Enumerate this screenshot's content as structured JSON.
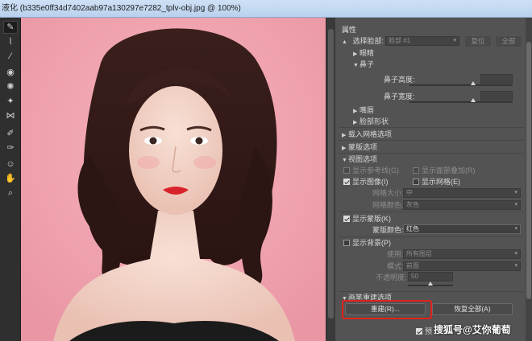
{
  "window": {
    "title": "液化 (b335e0ff34d7402aab97a130297e7282_tplv-obj.jpg @ 100%)"
  },
  "tools": [
    {
      "icon": "forward-warp-icon",
      "glyph": "✎",
      "active": true
    },
    {
      "icon": "reconstruct-icon",
      "glyph": "⌇"
    },
    {
      "icon": "smooth-icon",
      "glyph": "∕"
    },
    {
      "icon": "twirl-icon",
      "glyph": "◉"
    },
    {
      "icon": "pucker-icon",
      "glyph": "✺"
    },
    {
      "icon": "bloat-icon",
      "glyph": "✦"
    },
    {
      "icon": "push-left-icon",
      "glyph": "⋈"
    },
    {
      "icon": "freeze-mask-icon",
      "glyph": "✐"
    },
    {
      "icon": "thaw-mask-icon",
      "glyph": "✑"
    },
    {
      "icon": "face-tool-icon",
      "glyph": "☺"
    },
    {
      "icon": "hand-icon",
      "glyph": "✋"
    },
    {
      "icon": "zoom-icon",
      "glyph": "⌕"
    }
  ],
  "properties": {
    "header": "属性",
    "face_select_label": "选择脸部:",
    "face_select_value": "脸部 #1",
    "reset_label": "复位",
    "all_label": "全部",
    "eyes_label": "眼睛",
    "nose_label": "鼻子",
    "nose_height_label": "鼻子高度:",
    "nose_height_value": 0.62,
    "nose_width_label": "鼻子宽度:",
    "nose_width_value": 0.62,
    "mouth_label": "嘴唇",
    "face_shape_label": "脸部形状",
    "load_mesh_label": "载入网格选项",
    "mask_options_label": "蒙版选项",
    "view_options_label": "视图选项",
    "show_guides_label": "显示参考线(G)",
    "show_face_overlay_label": "显示面部叠加(R)",
    "show_image_label": "显示图像(I)",
    "show_mesh_label": "显示网格(E)",
    "mesh_size_label": "网格大小:",
    "mesh_size_value": "中",
    "mesh_color_label": "网格颜色:",
    "mesh_color_value": "灰色",
    "show_mask_label": "显示蒙版(K)",
    "mask_color_label": "蒙版颜色:",
    "mask_color_value": "红色",
    "show_backdrop_label": "显示背景(P)",
    "use_label": "使用:",
    "use_value": "所有图层",
    "mode_label": "模式:",
    "mode_value": "前面",
    "opacity_label": "不透明度:",
    "opacity_value": "50",
    "opacity_level": 0.5,
    "brush_reconstruct_label": "画笔重建选项",
    "reconstruct_button": "重建(R)...",
    "restore_all_button": "恢复全部(A)",
    "preview_label": "预"
  },
  "watermark": "搜狐号@艾你葡萄",
  "colors": {
    "mask_red": "#e0231c",
    "photo_bg": "#f0a4b0"
  }
}
